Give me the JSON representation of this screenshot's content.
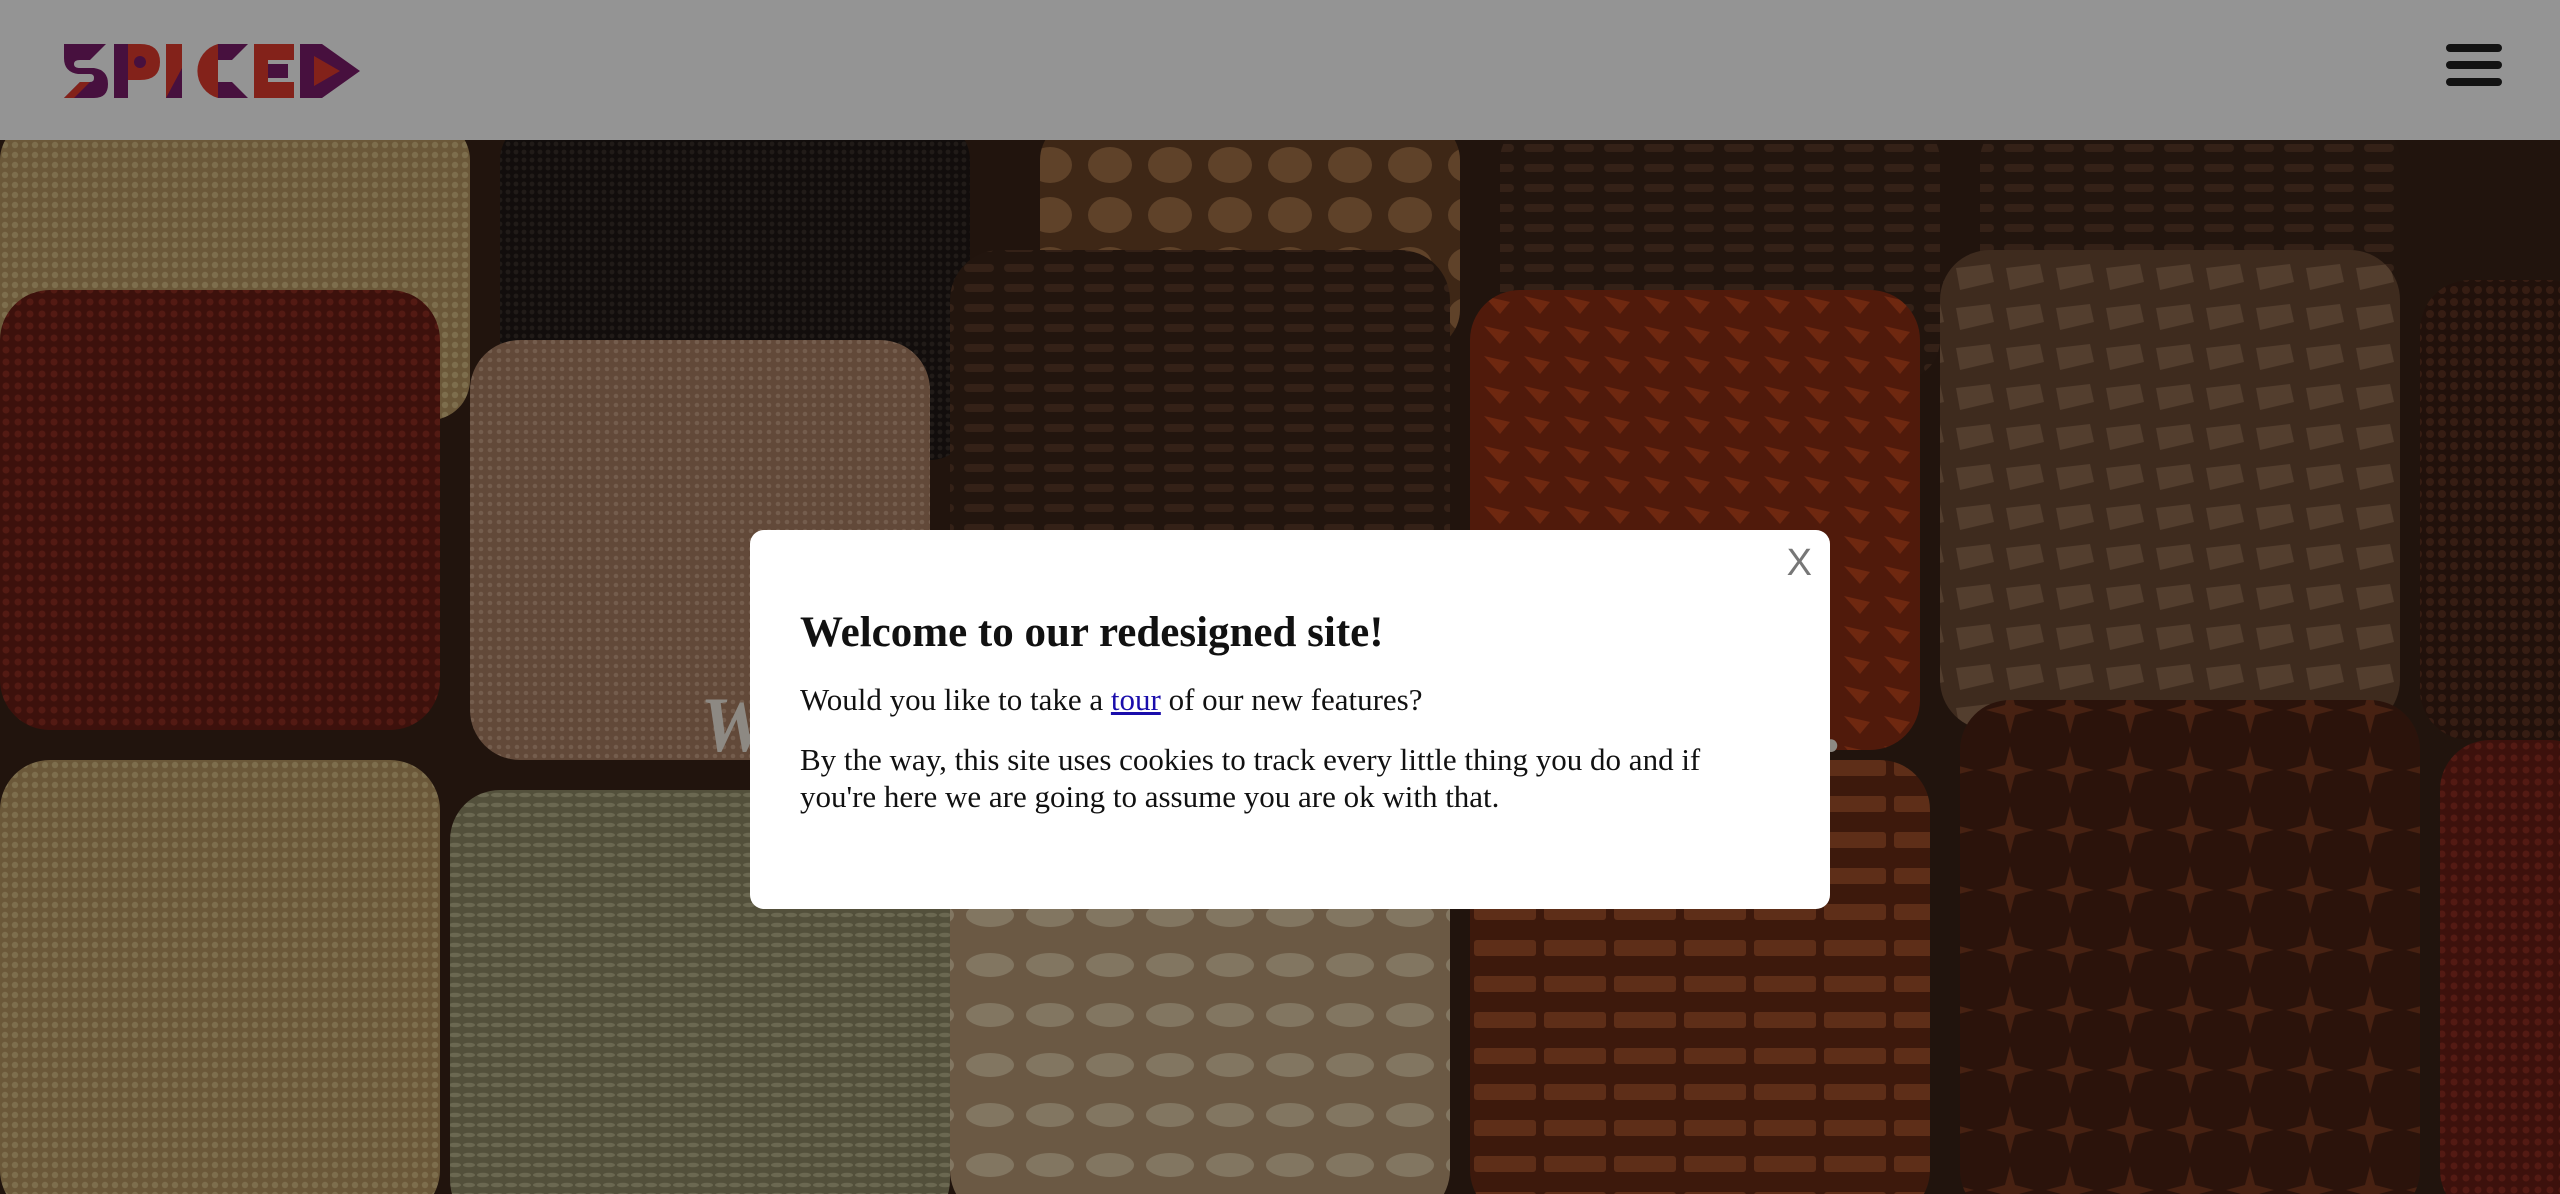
{
  "header": {
    "logo_text": "SPICED",
    "menu_icon": "hamburger-menu-icon"
  },
  "hero": {
    "heading_left": "W",
    "heading_right": "e."
  },
  "modal": {
    "close_label": "X",
    "title": "Welcome to our redesigned site!",
    "tour_prefix": "Would you like to take a ",
    "tour_link": "tour",
    "tour_suffix": " of our new features?",
    "cookie_text": "By the way, this site uses cookies to track every little thing you do and if you're here we are going to assume you are ok with that."
  },
  "colors": {
    "overlay": "rgba(0,0,0,0.42)",
    "link": "#1a0dab",
    "logo_primary": "#7a1d6b",
    "logo_secondary": "#e23b2e"
  }
}
